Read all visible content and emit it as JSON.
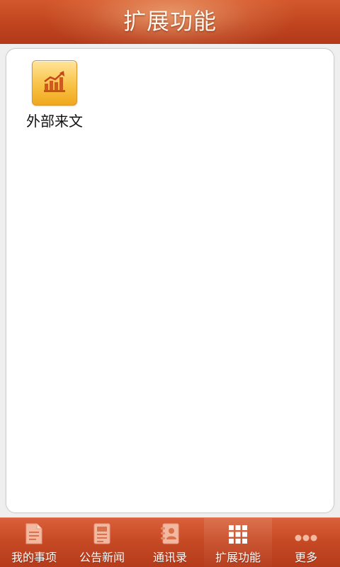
{
  "header": {
    "title": "扩展功能"
  },
  "apps": [
    {
      "label": "外部来文",
      "icon": "bar-chart-growth-icon"
    }
  ],
  "tabbar": {
    "active_index": 3,
    "items": [
      {
        "label": "我的事项",
        "icon": "document-icon"
      },
      {
        "label": "公告新闻",
        "icon": "newspaper-icon"
      },
      {
        "label": "通讯录",
        "icon": "contacts-book-icon"
      },
      {
        "label": "扩展功能",
        "icon": "grid-icon"
      },
      {
        "label": "更多",
        "icon": "more-dots-icon"
      }
    ]
  },
  "colors": {
    "header": "#c0451f",
    "tabbar": "#c74a25",
    "icon_tile": "#f8c246",
    "tab_icon_inactive": "#f3b8a0",
    "tab_icon_active": "#ffffff"
  }
}
